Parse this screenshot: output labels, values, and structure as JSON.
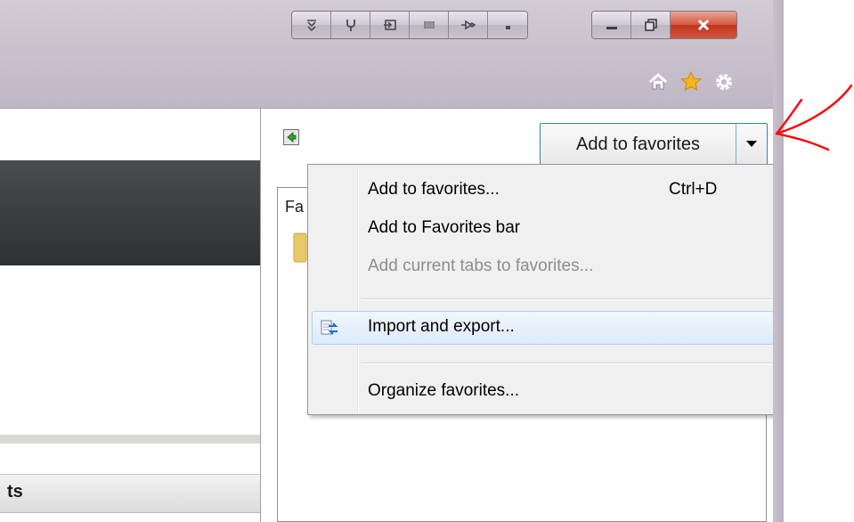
{
  "left_panel": {
    "section_header": "ts"
  },
  "favorites_pane": {
    "list_label": "Fa",
    "add_button": {
      "label": "Add to favorites"
    }
  },
  "menu": {
    "items": [
      {
        "label": "Add to favorites...",
        "shortcut": "Ctrl+D"
      },
      {
        "label": "Add to Favorites bar"
      },
      {
        "label": "Add current tabs to favorites..."
      },
      {
        "label": "Import and export..."
      },
      {
        "label": "Organize favorites..."
      }
    ]
  },
  "colors": {
    "chrome": "#c6bfcb",
    "close_button": "#c1341b",
    "hover_fill": "#dceafb",
    "annotation": "#ff0000",
    "favorites_star": "#f6b51e"
  },
  "icons": {
    "toolbar": [
      "scroll-down-icon",
      "tool-icon",
      "enter-icon",
      "grid-icon",
      "connector-icon",
      "dock-icon"
    ],
    "window": [
      "minimize-icon",
      "restore-icon",
      "close-icon"
    ],
    "command": [
      "home-icon",
      "favorites-star-icon",
      "gear-icon"
    ]
  }
}
